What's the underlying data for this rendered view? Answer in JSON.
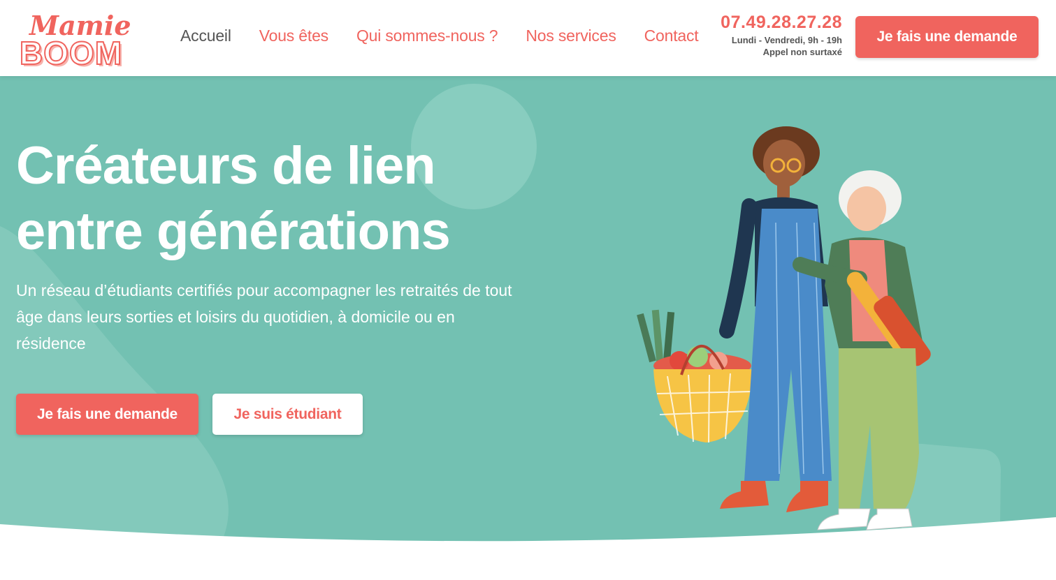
{
  "brand": {
    "logo_line1": "Mamie",
    "logo_line2": "BOOM",
    "primary_color": "#f0645e",
    "hero_color": "#73c1b2"
  },
  "nav": {
    "items": [
      {
        "label": "Accueil",
        "active": true
      },
      {
        "label": "Vous êtes",
        "active": false
      },
      {
        "label": "Qui sommes-nous ?",
        "active": false
      },
      {
        "label": "Nos services",
        "active": false
      },
      {
        "label": "Contact",
        "active": false
      }
    ]
  },
  "contact": {
    "phone": "07.49.28.27.28",
    "hours": "Lundi - Vendredi, 9h - 19h",
    "note": "Appel non surtaxé"
  },
  "header_cta": {
    "label": "Je fais une demande"
  },
  "hero": {
    "title_line1": "Créateurs de lien",
    "title_line2": "entre générations",
    "subtitle": "Un réseau d’étudiants certifiés pour accompagner les retraités de tout âge dans leurs sorties et loisirs du quotidien, à domicile ou en résidence",
    "primary_button": "Je fais une demande",
    "secondary_button": "Je suis étudiant",
    "illustration": "student-and-senior-with-shopping-basket"
  }
}
